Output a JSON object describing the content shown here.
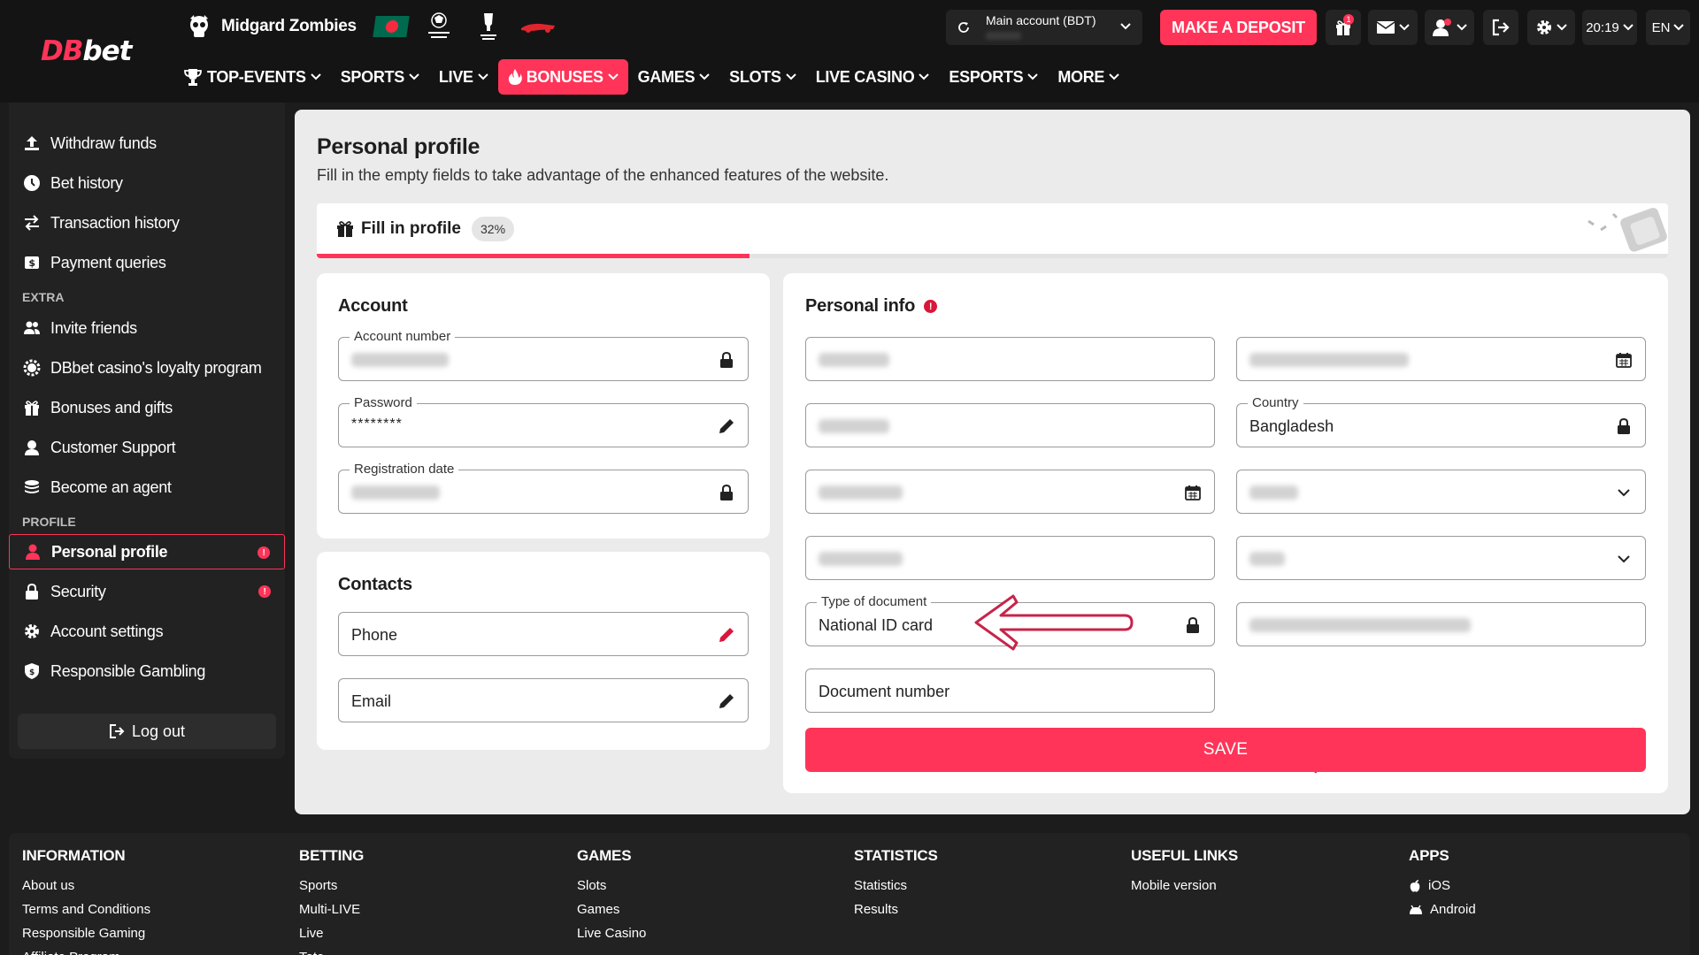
{
  "brand": {
    "logo_db": "DB",
    "logo_bet": "bet"
  },
  "promos": {
    "game_title": "Midgard Zombies",
    "champions_league_icon": "champions-league-icon",
    "europa_icon": "europa-league-icon",
    "f1_icon": "f1-car-icon",
    "flag": "bangladesh-flag"
  },
  "account": {
    "label": "Main account  (BDT)"
  },
  "header": {
    "deposit_label": "MAKE A DEPOSIT",
    "gift_badge": "1",
    "time": "20:19",
    "language": "EN"
  },
  "nav": [
    {
      "label": "TOP-EVENTS"
    },
    {
      "label": "SPORTS"
    },
    {
      "label": "LIVE"
    },
    {
      "label": "BONUSES"
    },
    {
      "label": "GAMES"
    },
    {
      "label": "SLOTS"
    },
    {
      "label": "LIVE CASINO"
    },
    {
      "label": "ESPORTS"
    },
    {
      "label": "MORE"
    }
  ],
  "sidebar": {
    "items_top": [
      {
        "label": "Withdraw funds"
      },
      {
        "label": "Bet history"
      },
      {
        "label": "Transaction history"
      },
      {
        "label": "Payment queries"
      }
    ],
    "extra_heading": "EXTRA",
    "items_extra": [
      {
        "label": "Invite friends"
      },
      {
        "label": "DBbet casino's loyalty program"
      },
      {
        "label": "Bonuses and gifts"
      },
      {
        "label": "Customer Support"
      },
      {
        "label": "Become an agent"
      }
    ],
    "profile_heading": "PROFILE",
    "items_profile": [
      {
        "label": "Personal profile"
      },
      {
        "label": "Security"
      },
      {
        "label": "Account settings"
      },
      {
        "label": "Responsible Gambling"
      }
    ],
    "logout_label": "Log out"
  },
  "main": {
    "title": "Personal profile",
    "subtitle": "Fill in the empty fields to take advantage of the enhanced features of the website.",
    "fill_label": "Fill in profile",
    "fill_percent_label": "32%",
    "fill_progress": 0.32
  },
  "account_card": {
    "title": "Account",
    "account_number_label": "Account number",
    "password_label": "Password",
    "password_value": "********",
    "registration_label": "Registration date"
  },
  "contacts_card": {
    "title": "Contacts",
    "phone_placeholder": "Phone",
    "email_placeholder": "Email"
  },
  "personal_card": {
    "title": "Personal info",
    "country_label": "Country",
    "country_value": "Bangladesh",
    "doc_type_label": "Type of document",
    "doc_type_value": "National ID card",
    "doc_number_placeholder": "Document number",
    "save_label": "SAVE"
  },
  "footer": {
    "columns": [
      {
        "heading": "INFORMATION",
        "links": [
          "About us",
          "Terms and Conditions",
          "Responsible Gaming",
          "Affiliate Program"
        ]
      },
      {
        "heading": "BETTING",
        "links": [
          "Sports",
          "Multi-LIVE",
          "Live",
          "Toto"
        ]
      },
      {
        "heading": "GAMES",
        "links": [
          "Slots",
          "Games",
          "Live Casino"
        ]
      },
      {
        "heading": "STATISTICS",
        "links": [
          "Statistics",
          "Results"
        ]
      },
      {
        "heading": "USEFUL LINKS",
        "links": [
          "Mobile version"
        ]
      },
      {
        "heading": "APPS",
        "links": [
          "iOS",
          "Android"
        ]
      }
    ]
  },
  "colors": {
    "accent": "#ff3458",
    "background": "#1c1c1c",
    "panel": "#ebebeb"
  }
}
